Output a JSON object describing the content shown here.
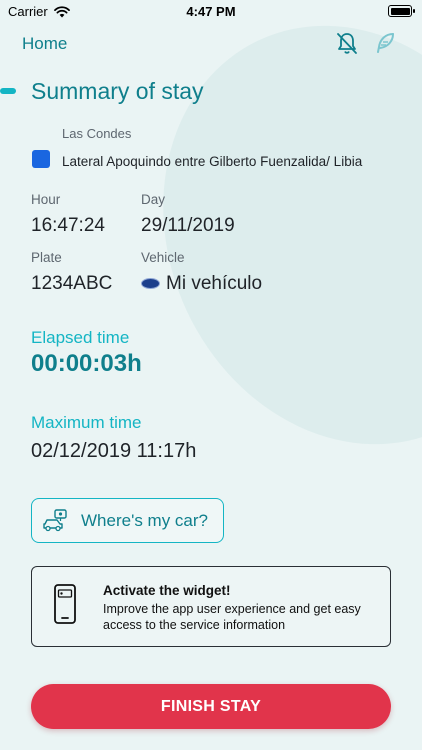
{
  "status_bar": {
    "carrier": "Carrier",
    "time": "4:47 PM"
  },
  "nav": {
    "home_label": "Home",
    "icons": [
      "bell-off-icon",
      "edit-feather-icon"
    ]
  },
  "summary": {
    "title": "Summary of stay",
    "region": "Las Condes",
    "street": "Lateral Apoquindo entre Gilberto Fuenzalida/ Libia",
    "hour_label": "Hour",
    "hour_value": "16:47:24",
    "day_label": "Day",
    "day_value": "29/11/2019",
    "plate_label": "Plate",
    "plate_value": "1234ABC",
    "vehicle_label": "Vehicle",
    "vehicle_value": "Mi vehículo"
  },
  "elapsed": {
    "label": "Elapsed time",
    "value": "00:00:03h"
  },
  "maximum": {
    "label": "Maximum time",
    "value": "02/12/2019 11:17h"
  },
  "car_button": {
    "label": "Where's my car?"
  },
  "widget": {
    "title": "Activate the widget!",
    "description": "Improve the app user experience and get easy access to the service information"
  },
  "finish_button": {
    "label": "FINISH STAY"
  },
  "colors": {
    "accent": "#14b5c4",
    "teal_dark": "#0f7f8c",
    "danger": "#e1344b",
    "zone_square": "#1a66e0",
    "background": "#eaf4f4"
  }
}
